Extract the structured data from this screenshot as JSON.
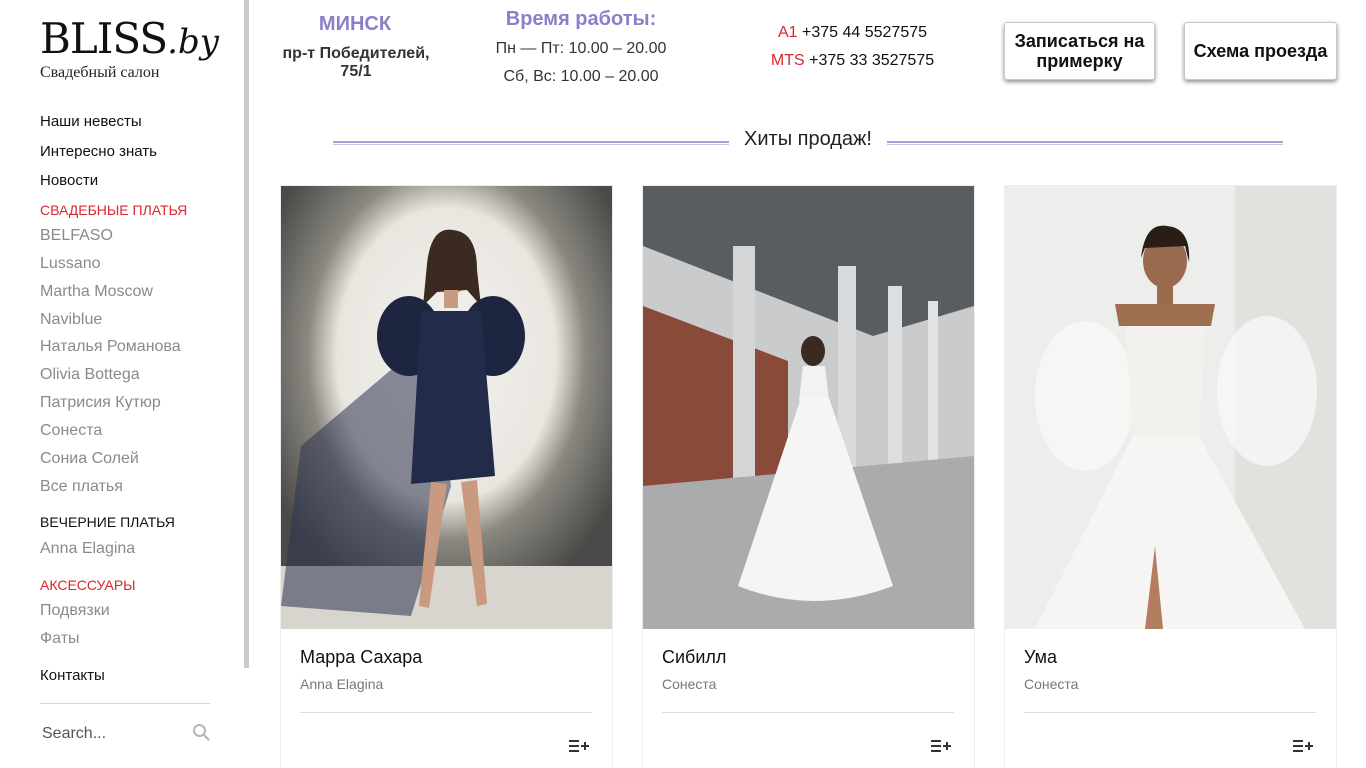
{
  "logo": {
    "brand": "BLISS",
    "suffix": ".by",
    "tagline": "Свадебный салон"
  },
  "sidebar": {
    "links": [
      "Наши невесты",
      "Интересно знать",
      "Новости"
    ],
    "wedding": {
      "heading": "СВАДЕБНЫЕ ПЛАТЬЯ",
      "items": [
        "BELFASO",
        "Lussano",
        "Martha Moscow",
        "Naviblue",
        "Наталья Романова",
        "Olivia Bottega",
        "Патрисия Кутюр",
        "Сонеста",
        "Сониа Солей",
        "Все платья"
      ]
    },
    "evening": {
      "heading": "ВЕЧЕРНИЕ ПЛАТЬЯ",
      "items": [
        "Anna Elagina"
      ]
    },
    "accessories": {
      "heading": "АКСЕССУАРЫ",
      "items": [
        "Подвязки",
        "Фаты"
      ]
    },
    "contacts": "Контакты",
    "search_placeholder": "Search..."
  },
  "header": {
    "city": "МИНСК",
    "address": "пр-т Победителей, 75/1",
    "hours_title": "Время работы:",
    "hours": [
      "Пн — Пт: 10.00 – 20.00",
      "Сб, Вс: 10.00 – 20.00"
    ],
    "phones": [
      {
        "operator": "A1",
        "number": "+375 44 5527575"
      },
      {
        "operator": "MTS",
        "number": "+375 33 3527575"
      }
    ],
    "btn_fitting": "Записаться на примерку",
    "btn_map": "Схема проезда"
  },
  "section_title": "Хиты продаж!",
  "products": [
    {
      "name": "Марра Сахара",
      "brand": "Anna Elagina"
    },
    {
      "name": "Сибилл",
      "brand": "Сонеста"
    },
    {
      "name": "Ума",
      "brand": "Сонеста"
    }
  ],
  "colors": {
    "accent": "#8c7fc9",
    "red": "#d9272e",
    "muted": "#8a8a8a"
  }
}
